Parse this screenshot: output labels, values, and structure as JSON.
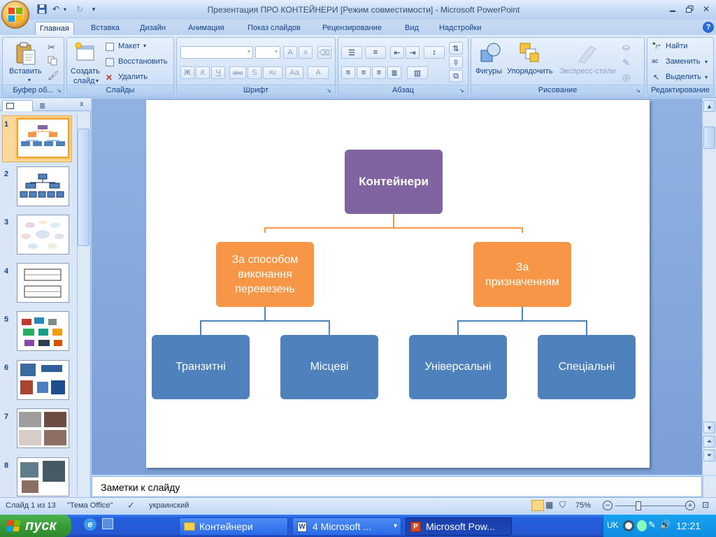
{
  "window": {
    "title": "Презентация ПРО КОНТЕЙНЕРИ [Режим совместимости] - Microsoft PowerPoint"
  },
  "ribbon_tabs": [
    "Главная",
    "Вставка",
    "Дизайн",
    "Анимация",
    "Показ слайдов",
    "Рецензирование",
    "Вид",
    "Надстройки"
  ],
  "ribbon": {
    "clipboard": {
      "label": "Буфер об...",
      "paste": "Вставить"
    },
    "slides": {
      "label": "Слайды",
      "new_slide_1": "Создать",
      "new_slide_2": "слайд",
      "layout": "Макет",
      "reset": "Восстановить",
      "delete": "Удалить"
    },
    "font": {
      "label": "Шрифт",
      "bold": "Ж",
      "italic": "К",
      "underline": "Ч",
      "strike": "abc",
      "shadow": "S",
      "spacing": "AV",
      "case": "Aa",
      "color": "A",
      "grow": "A",
      "shrink": "A"
    },
    "paragraph": {
      "label": "Абзац"
    },
    "drawing": {
      "label": "Рисование",
      "shapes": "Фигуры",
      "arrange": "Упорядочить",
      "quick_styles": "Экспресс-стили"
    },
    "editing": {
      "label": "Редактирование",
      "find": "Найти",
      "replace": "Заменить",
      "select": "Выделить"
    }
  },
  "thumbnails": {
    "numbers": [
      "1",
      "2",
      "3",
      "4",
      "5",
      "6",
      "7",
      "8"
    ],
    "selected": "1"
  },
  "slide": {
    "root": "Контейнери",
    "left_branch": "За способом виконання перевезень",
    "right_branch": "За призначенням",
    "leaves": [
      "Транзитні",
      "Місцеві",
      "Універсальні",
      "Спеціальні"
    ],
    "colors": {
      "root": "#8064a2",
      "branch": "#f79646",
      "leaf": "#4f81bd",
      "line_top": "#f79646",
      "line_bottom": "#4f81bd"
    }
  },
  "notes": {
    "placeholder": "Заметки к слайду"
  },
  "status": {
    "slide": "Слайд 1 из 13",
    "theme": "\"Тема Office\"",
    "language": "украинский",
    "zoom": "75%"
  },
  "taskbar": {
    "start": "пуск",
    "tasks": [
      {
        "label": "Контейнери",
        "icon": "folder-icon"
      },
      {
        "label": "4 Microsoft ...",
        "icon": "word-icon"
      },
      {
        "label": "Microsoft Pow...",
        "icon": "powerpoint-icon"
      }
    ],
    "language": "UK",
    "clock": "12:21"
  }
}
